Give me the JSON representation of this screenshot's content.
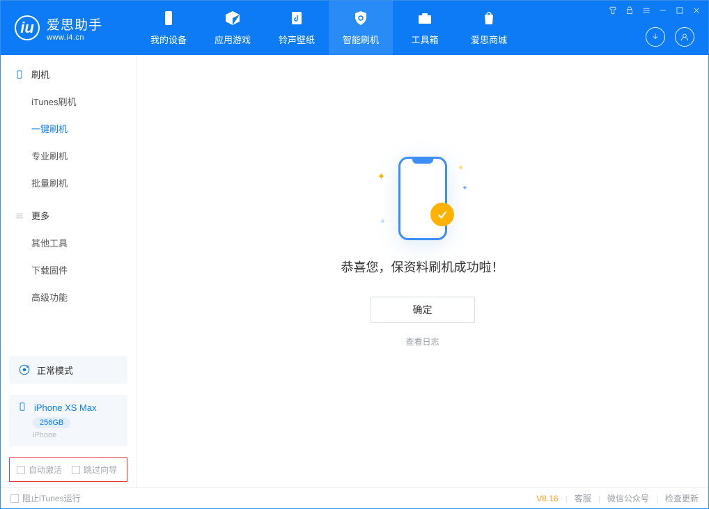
{
  "app": {
    "name": "爱思助手",
    "site": "www.i4.cn"
  },
  "tabs": [
    {
      "label": "我的设备"
    },
    {
      "label": "应用游戏"
    },
    {
      "label": "铃声壁纸"
    },
    {
      "label": "智能刷机"
    },
    {
      "label": "工具箱"
    },
    {
      "label": "爱思商城"
    }
  ],
  "sidebar": {
    "group1": {
      "title": "刷机",
      "items": [
        "iTunes刷机",
        "一键刷机",
        "专业刷机",
        "批量刷机"
      ]
    },
    "group2": {
      "title": "更多",
      "items": [
        "其他工具",
        "下载固件",
        "高级功能"
      ]
    }
  },
  "mode": {
    "label": "正常模式"
  },
  "device": {
    "name": "iPhone XS Max",
    "capacity": "256GB",
    "type": "iPhone"
  },
  "checkboxes": {
    "auto_activate": "自动激活",
    "skip_guide": "跳过向导"
  },
  "main": {
    "success": "恭喜您，保资料刷机成功啦！",
    "ok": "确定",
    "log": "查看日志"
  },
  "footer": {
    "block_itunes": "阻止iTunes运行",
    "version": "V8.16",
    "support": "客服",
    "wechat": "微信公众号",
    "update": "检查更新"
  }
}
